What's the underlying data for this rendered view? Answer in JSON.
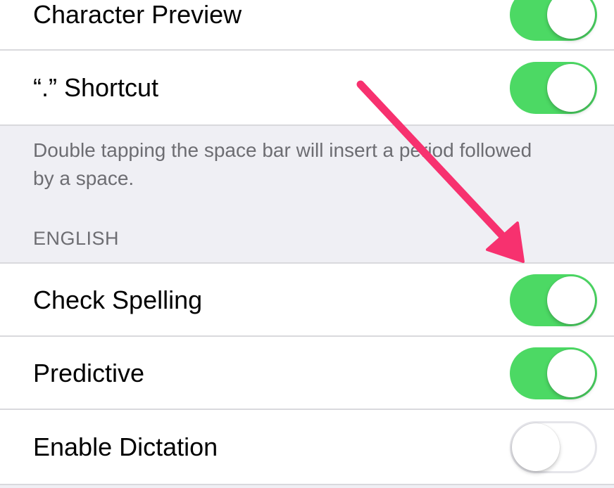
{
  "settings": {
    "rows_top": [
      {
        "label": "Character Preview",
        "state": "on"
      },
      {
        "label": "“.” Shortcut",
        "state": "on"
      }
    ],
    "shortcut_footer": "Double tapping the space bar will insert a period followed by a space.",
    "section_header": "ENGLISH",
    "rows_english": [
      {
        "label": "Check Spelling",
        "state": "on"
      },
      {
        "label": "Predictive",
        "state": "on"
      },
      {
        "label": "Enable Dictation",
        "state": "off"
      }
    ]
  },
  "colors": {
    "toggle_on": "#4cd964",
    "toggle_off_border": "#e5e5ea",
    "group_background": "#efeff4",
    "annotation_arrow": "#f7316f"
  },
  "annotation": {
    "type": "arrow",
    "points_to": "check-spelling-toggle"
  }
}
